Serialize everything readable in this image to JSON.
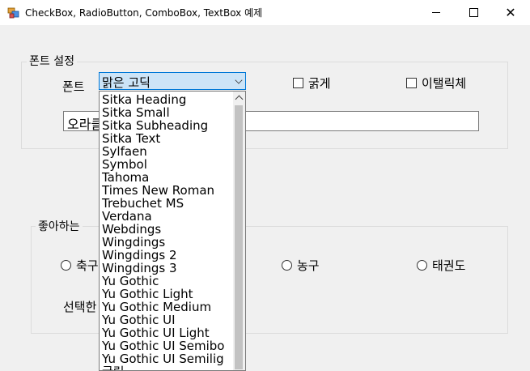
{
  "window": {
    "title": "CheckBox, RadioButton, ComboBox, TextBox 예제"
  },
  "font_group": {
    "legend": "폰트 설정",
    "font_label": "폰트",
    "combo_value": "맑은 고딕",
    "bold_label": "굵게",
    "italic_label": "이탤릭체",
    "text_value": "오라클"
  },
  "sport_group": {
    "legend": "좋아하는",
    "options": [
      "축구",
      "농구",
      "태권도"
    ],
    "selected_label": "선택한"
  },
  "dropdown": {
    "items": [
      "Sitka Heading",
      "Sitka Small",
      "Sitka Subheading",
      "Sitka Text",
      "Sylfaen",
      "Symbol",
      "Tahoma",
      "Times New Roman",
      "Trebuchet MS",
      "Verdana",
      "Webdings",
      "Wingdings",
      "Wingdings 2",
      "Wingdings 3",
      "Yu Gothic",
      "Yu Gothic Light",
      "Yu Gothic Medium",
      "Yu Gothic UI",
      "Yu Gothic UI Light",
      "Yu Gothic UI Semibo",
      "Yu Gothic UI Semilig",
      "굴림"
    ]
  },
  "colors": {
    "selection": "#cce4f7",
    "accent": "#0078d7"
  }
}
